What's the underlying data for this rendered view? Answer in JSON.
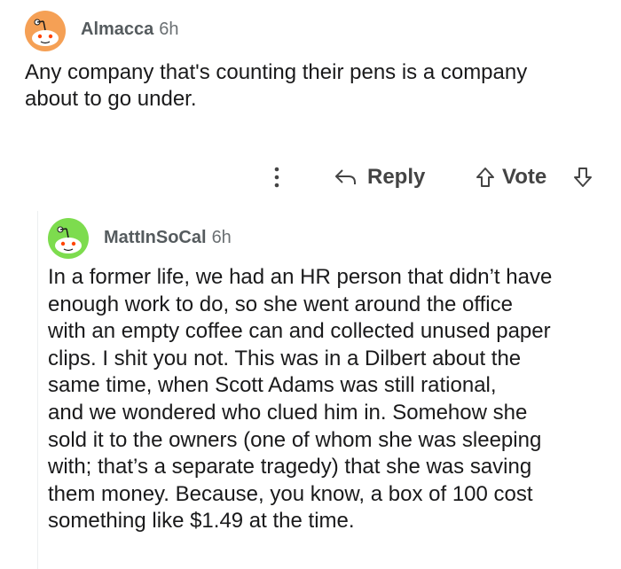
{
  "comment": {
    "author": "Almacca",
    "time": "6h",
    "avatar_color": "#f5a055",
    "body_lines": [
      "Any company that's counting their pens is a company",
      "about to go under."
    ]
  },
  "actions": {
    "more_icon": "vertical-dots-icon",
    "reply_label": "Reply",
    "vote_label": "Vote"
  },
  "reply": {
    "author": "MattInSoCal",
    "time": "6h",
    "avatar_color": "#7ddc4e",
    "body_lines": [
      "In a former life, we had an HR person that didn’t have",
      "enough work to do, so she went around the office",
      "with an empty coffee can and collected unused paper",
      "clips. I shit you not. This was in a Dilbert about the",
      "same time, when Scott Adams was still rational,",
      "and we wondered who clued him in. Somehow she",
      "sold it to the owners (one of whom she was sleeping",
      "with; that’s a separate tragedy) that she was saving",
      "them money. Because, you know, a box of 100 cost",
      "something like $1.49 at the time."
    ]
  }
}
